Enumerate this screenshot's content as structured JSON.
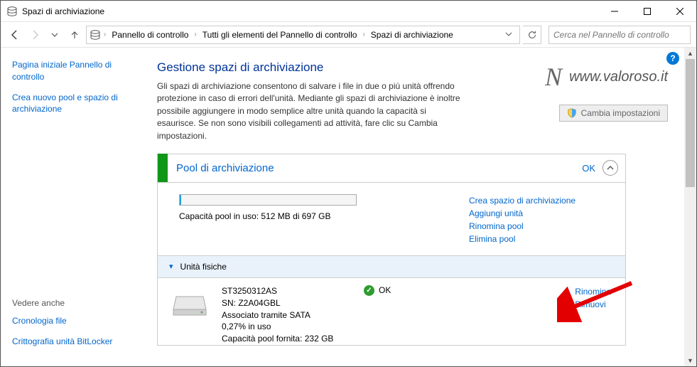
{
  "window": {
    "title": "Spazi di archiviazione"
  },
  "breadcrumb": {
    "items": [
      "Pannello di controllo",
      "Tutti gli elementi del Pannello di controllo",
      "Spazi di archiviazione"
    ]
  },
  "search": {
    "placeholder": "Cerca nel Pannello di controllo"
  },
  "sidebar": {
    "link_home": "Pagina iniziale Pannello di controllo",
    "link_new": "Crea nuovo pool e spazio di archiviazione",
    "see_also": "Vedere anche",
    "link_history": "Cronologia file",
    "link_bitlocker": "Crittografia unità BitLocker"
  },
  "main": {
    "heading": "Gestione spazi di archiviazione",
    "description": "Gli spazi di archiviazione consentono di salvare i file in due o più unità offrendo protezione in caso di errori dell'unità. Mediante gli spazi di archiviazione è inoltre possibile aggiungere in modo semplice altre unità quando la capacità si esaurisce. Se non sono visibili collegamenti ad attività, fare clic su Cambia impostazioni.",
    "change_button": "Cambia impostazioni",
    "watermark": "www.valoroso.it"
  },
  "pool": {
    "name": "Pool di archiviazione",
    "status": "OK",
    "capacity_text": "Capacità pool in uso: 512 MB di 697 GB",
    "links": {
      "create": "Crea spazio di archiviazione",
      "add": "Aggiungi unità",
      "rename": "Rinomina pool",
      "delete": "Elimina pool"
    },
    "physical": {
      "header": "Unità fisiche",
      "drive": {
        "model": "ST3250312AS",
        "serial": "SN: Z2A04GBL",
        "connection": "Associato tramite SATA",
        "usage": "0,27% in uso",
        "capacity": "Capacità pool fornita: 232 GB",
        "status": "OK",
        "link_rename": "Rinomina",
        "link_remove": "Rimuovi"
      }
    }
  }
}
